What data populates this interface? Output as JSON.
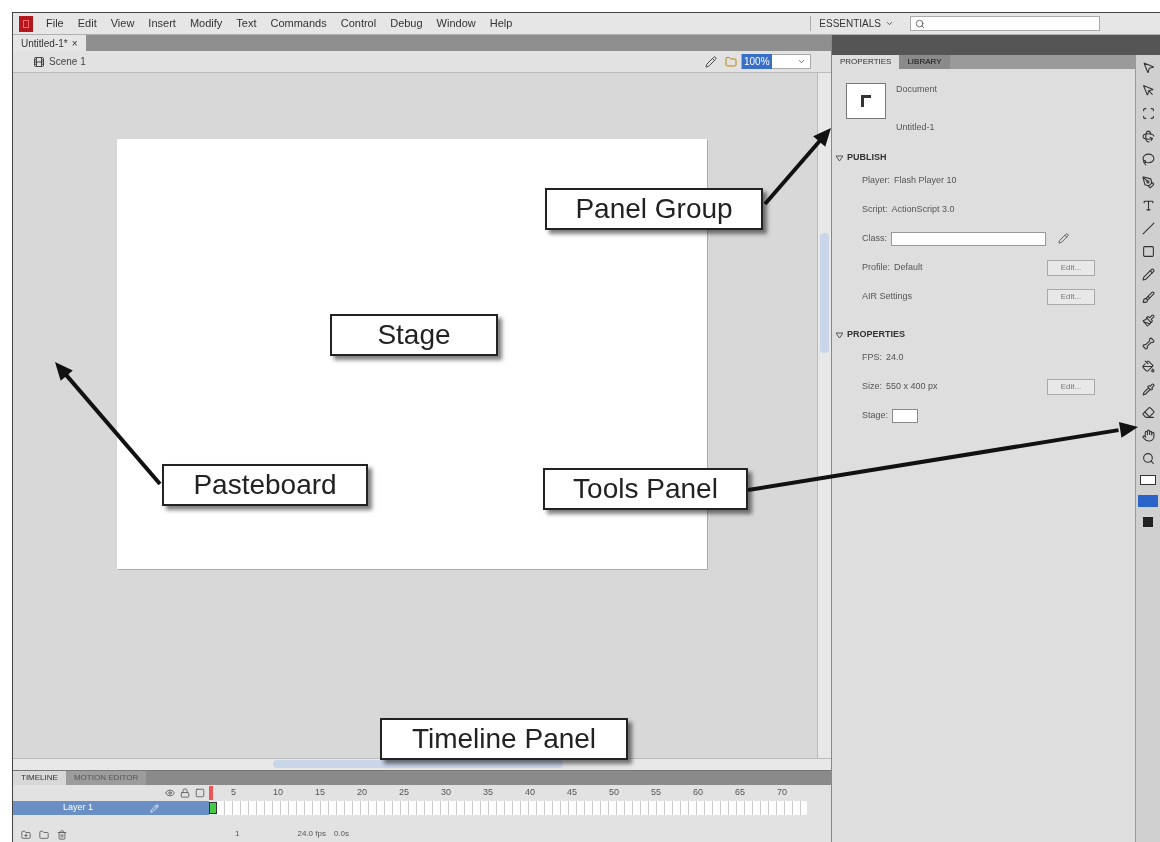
{
  "menu_bar": {
    "items": [
      "File",
      "Edit",
      "View",
      "Insert",
      "Modify",
      "Text",
      "Commands",
      "Control",
      "Debug",
      "Window",
      "Help"
    ],
    "workspace": "ESSENTIALS"
  },
  "document_tabs": [
    {
      "label": "Untitled-1*",
      "close": "×",
      "selected": true
    }
  ],
  "edit_bar": {
    "scene": "Scene 1",
    "zoom": "100%"
  },
  "properties_panel": {
    "tabs": [
      {
        "label": "PROPERTIES",
        "selected": true
      },
      {
        "label": "LIBRARY",
        "selected": false
      }
    ],
    "document_type": "Document",
    "document_name": "Untitled-1",
    "sections": [
      {
        "title": "PUBLISH",
        "expanded": true,
        "rows": [
          {
            "kind": "text",
            "label": "Player:",
            "value": "Flash Player 10"
          },
          {
            "kind": "text",
            "label": "Script:",
            "value": "ActionScript 3.0"
          },
          {
            "kind": "field",
            "label": "Class:"
          },
          {
            "kind": "button",
            "label": "Profile:",
            "value": "Default",
            "button": "Edit..."
          },
          {
            "kind": "button",
            "label": "AIR Settings",
            "button": "Edit..."
          }
        ]
      },
      {
        "title": "PROPERTIES",
        "expanded": true,
        "rows": [
          {
            "kind": "text",
            "label": "FPS:",
            "value": "24.0"
          },
          {
            "kind": "button",
            "label": "Size:",
            "value": "550 x 400 px",
            "button": "Edit..."
          },
          {
            "kind": "swatch",
            "label": "Stage:"
          }
        ]
      }
    ]
  },
  "timeline": {
    "tabs": [
      {
        "label": "TIMELINE",
        "selected": true
      },
      {
        "label": "MOTION EDITOR",
        "selected": false
      }
    ],
    "frame_numbers": [
      "5",
      "10",
      "15",
      "20",
      "25",
      "30",
      "35",
      "40",
      "45",
      "50",
      "55",
      "60",
      "65",
      "70"
    ],
    "layers": [
      {
        "name": "Layer 1",
        "selected": true
      }
    ],
    "status": {
      "frame": "1",
      "fps": "24.0 fps",
      "time": "0.0s"
    }
  },
  "callouts": [
    {
      "text": "Panel Group"
    },
    {
      "text": "Stage"
    },
    {
      "text": "Pasteboard"
    },
    {
      "text": "Tools Panel"
    },
    {
      "text": "Timeline Panel"
    }
  ]
}
